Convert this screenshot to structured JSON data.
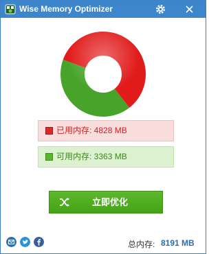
{
  "app": {
    "title": "Wise Memory Optimizer",
    "logo_icon": "chip-icon",
    "settings_icon": "gear-icon",
    "close_icon": "close-icon"
  },
  "chart_data": {
    "type": "pie",
    "categories": [
      "已用内存",
      "可用内存"
    ],
    "values": [
      4828,
      3363
    ],
    "colors": [
      "#e11a1a",
      "#48a32a"
    ],
    "unit": "MB"
  },
  "memory": {
    "used_text": "已用内存: 4828 MB",
    "free_text": "可用内存: 3363 MB",
    "used_color": "#dc2a2a",
    "free_color": "#5ab72c"
  },
  "actions": {
    "optimize_label": "立即优化",
    "optimize_icon": "shuffle-icon"
  },
  "footer": {
    "social": [
      {
        "name": "email-icon",
        "color": "#2a6fb3"
      },
      {
        "name": "twitter-icon",
        "color": "#2a91d6"
      },
      {
        "name": "facebook-icon",
        "color": "#355ea3"
      }
    ],
    "total_label": "总内存:",
    "total_value": "8191 MB"
  }
}
